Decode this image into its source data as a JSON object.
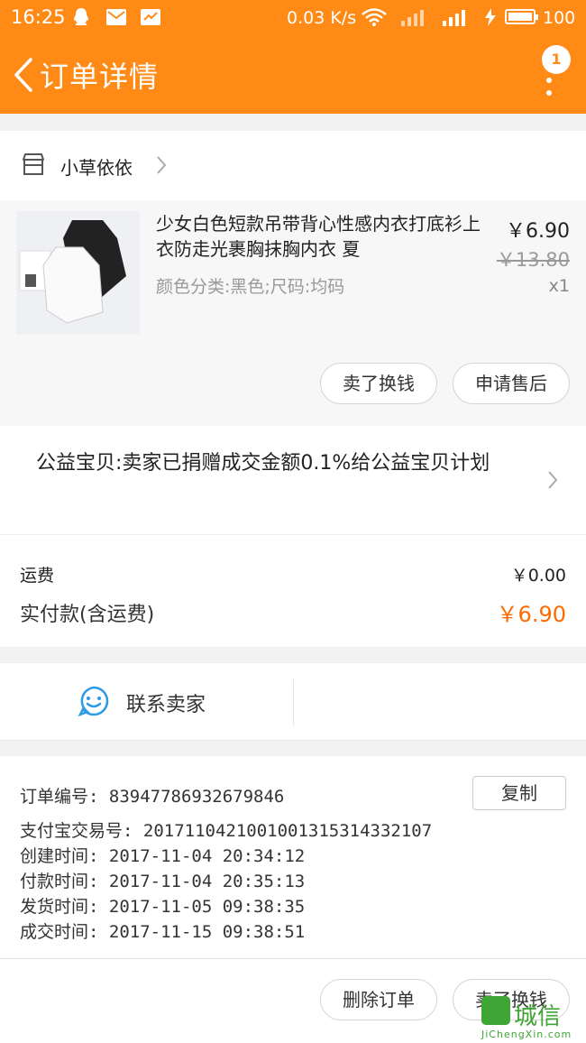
{
  "status_bar": {
    "time": "16:25",
    "speed": "0.03 K/s",
    "battery": "100"
  },
  "header": {
    "title": "订单详情",
    "badge_count": "1"
  },
  "store": {
    "name": "小草依依"
  },
  "product": {
    "title": "少女白色短款吊带背心性感内衣打底衫上衣防走光裹胸抹胸内衣 夏",
    "variant": "颜色分类:黑色;尺码:均码",
    "price": "￥6.90",
    "original_price": "￥13.80",
    "quantity": "x1",
    "buttons": [
      "卖了换钱",
      "申请售后"
    ]
  },
  "charity": {
    "text": "公益宝贝:卖家已捐赠成交金额0.1%给公益宝贝计划"
  },
  "fees": {
    "shipping_label": "运费",
    "shipping_value": "￥0.00",
    "total_label": "实付款(含运费)",
    "total_value": "￥6.90"
  },
  "contact": {
    "label": "联系卖家"
  },
  "order_info": {
    "order_no": "订单编号:  83947786932679846",
    "alipay_no": "支付宝交易号:  2017110421001001315314332107",
    "created": "创建时间:  2017-11-04 20:34:12",
    "paid": "付款时间:  2017-11-04 20:35:13",
    "shipped": "发货时间:  2017-11-05 09:38:35",
    "completed": "成交时间:  2017-11-15 09:38:51",
    "copy_label": "复制"
  },
  "bottom_bar": {
    "delete_label": "删除订单",
    "sell_label": "卖了换钱"
  },
  "watermark": {
    "cn": "城信",
    "en": "JiChengXin.com"
  },
  "colors": {
    "brand_orange": "#ff8a16",
    "price_orange": "#ff6a00"
  }
}
